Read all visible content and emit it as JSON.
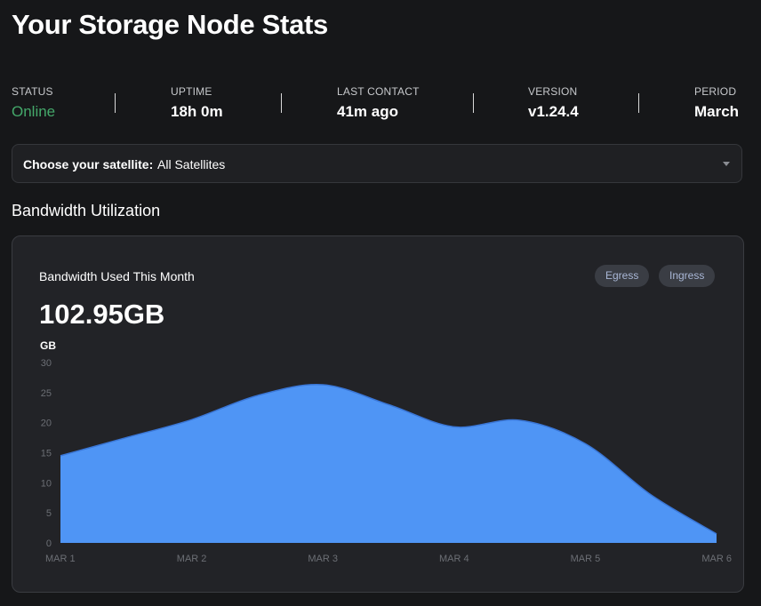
{
  "page": {
    "title": "Your Storage Node Stats"
  },
  "stats": [
    {
      "label": "STATUS",
      "value": "Online"
    },
    {
      "label": "UPTIME",
      "value": "18h 0m"
    },
    {
      "label": "LAST CONTACT",
      "value": "41m ago"
    },
    {
      "label": "VERSION",
      "value": "v1.24.4"
    },
    {
      "label": "PERIOD",
      "value": "March"
    }
  ],
  "satellite": {
    "label": "Choose your satellite:",
    "value": "All Satellites"
  },
  "bandwidth": {
    "section_title": "Bandwidth Utilization",
    "card_title": "Bandwidth Used This Month",
    "total": "102.95GB",
    "toggles": [
      "Egress",
      "Ingress"
    ]
  },
  "colors": {
    "online": "#44a86a",
    "area_fill": "#4f95f5",
    "area_stroke": "#3a76d6",
    "background": "#161719",
    "card": "#222327"
  },
  "chart_data": {
    "type": "area",
    "ylabel": "GB",
    "y_ticks": [
      0,
      5,
      10,
      15,
      20,
      25,
      30
    ],
    "ylim": [
      0,
      30
    ],
    "categories": [
      "MAR 1",
      "MAR 2",
      "MAR 3",
      "MAR 4",
      "MAR 5",
      "MAR 6"
    ],
    "x": [
      0,
      0.5,
      1,
      1.5,
      2,
      2.5,
      3,
      3.5,
      4,
      4.5,
      5
    ],
    "values": [
      14.5,
      17.5,
      20.5,
      24.5,
      26.3,
      23,
      19.3,
      20.4,
      16.5,
      8,
      1.5
    ],
    "grid": false,
    "legend": "none"
  }
}
